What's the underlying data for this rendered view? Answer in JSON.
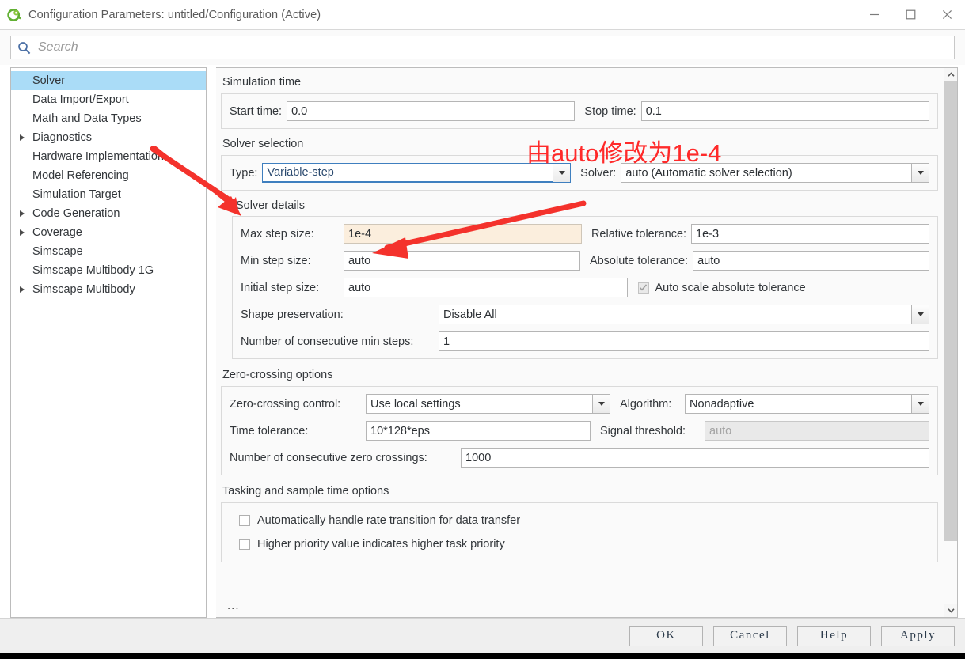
{
  "window": {
    "title": "Configuration Parameters: untitled/Configuration (Active)",
    "app_icon": "simulink-logo-icon",
    "controls": {
      "minimize": "minimize-icon",
      "maximize": "maximize-icon",
      "close": "close-icon"
    }
  },
  "search": {
    "placeholder": "Search",
    "icon": "search-icon",
    "value": ""
  },
  "sidebar": {
    "items": [
      {
        "label": "Solver",
        "expandable": false,
        "selected": true
      },
      {
        "label": "Data Import/Export",
        "expandable": false,
        "selected": false
      },
      {
        "label": "Math and Data Types",
        "expandable": false,
        "selected": false
      },
      {
        "label": "Diagnostics",
        "expandable": true,
        "selected": false
      },
      {
        "label": "Hardware Implementation",
        "expandable": false,
        "selected": false
      },
      {
        "label": "Model Referencing",
        "expandable": false,
        "selected": false
      },
      {
        "label": "Simulation Target",
        "expandable": false,
        "selected": false
      },
      {
        "label": "Code Generation",
        "expandable": true,
        "selected": false
      },
      {
        "label": "Coverage",
        "expandable": true,
        "selected": false
      },
      {
        "label": "Simscape",
        "expandable": false,
        "selected": false
      },
      {
        "label": "Simscape Multibody 1G",
        "expandable": false,
        "selected": false
      },
      {
        "label": "Simscape Multibody",
        "expandable": true,
        "selected": false
      }
    ]
  },
  "main": {
    "simulation_time": {
      "title": "Simulation time",
      "start_time_label": "Start time:",
      "start_time_value": "0.0",
      "stop_time_label": "Stop time:",
      "stop_time_value": "0.1"
    },
    "solver_selection": {
      "title": "Solver selection",
      "type_label": "Type:",
      "type_value": "Variable-step",
      "solver_label": "Solver:",
      "solver_value": "auto (Automatic solver selection)"
    },
    "solver_details": {
      "title": "Solver details",
      "expanded": true,
      "max_step_label": "Max step size:",
      "max_step_value": "1e-4",
      "rel_tol_label": "Relative tolerance:",
      "rel_tol_value": "1e-3",
      "min_step_label": "Min step size:",
      "min_step_value": "auto",
      "abs_tol_label": "Absolute tolerance:",
      "abs_tol_value": "auto",
      "initial_step_label": "Initial step size:",
      "initial_step_value": "auto",
      "auto_scale_label": "Auto scale absolute tolerance",
      "auto_scale_checked": true,
      "shape_pres_label": "Shape preservation:",
      "shape_pres_value": "Disable All",
      "consec_min_steps_label": "Number of consecutive min steps:",
      "consec_min_steps_value": "1"
    },
    "zero_crossing": {
      "title": "Zero-crossing options",
      "control_label": "Zero-crossing control:",
      "control_value": "Use local settings",
      "algorithm_label": "Algorithm:",
      "algorithm_value": "Nonadaptive",
      "time_tol_label": "Time tolerance:",
      "time_tol_value": "10*128*eps",
      "signal_thresh_label": "Signal threshold:",
      "signal_thresh_value": "auto",
      "consec_zc_label": "Number of consecutive zero crossings:",
      "consec_zc_value": "1000"
    },
    "tasking": {
      "title": "Tasking and sample time options",
      "auto_rate_label": "Automatically handle rate transition for data transfer",
      "auto_rate_checked": false,
      "higher_priority_label": "Higher priority value indicates higher task priority",
      "higher_priority_checked": false
    },
    "overflow_ellipsis": "..."
  },
  "footer": {
    "ok_label": "OK",
    "cancel_label": "Cancel",
    "help_label": "Help",
    "apply_label": "Apply"
  },
  "annotations": {
    "note_text": "由auto修改为1e-4",
    "color": "#ff2a2a",
    "arrows": [
      {
        "name": "arrow-to-solver-details"
      },
      {
        "name": "arrow-to-max-step-size"
      }
    ]
  },
  "scrollbar": {
    "up_icon": "chevron-up-icon",
    "down_icon": "chevron-down-icon"
  }
}
